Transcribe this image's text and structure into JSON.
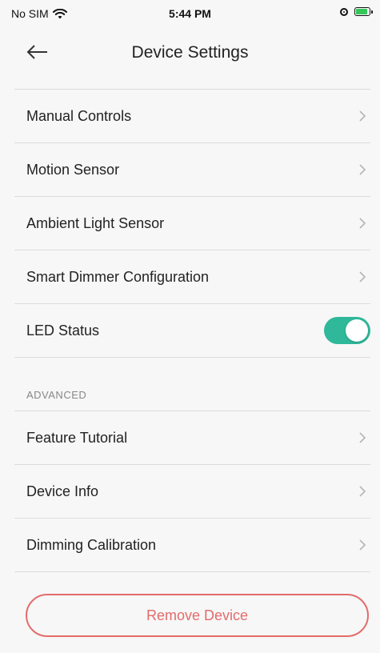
{
  "status_bar": {
    "carrier": "No SIM",
    "time": "5:44 PM"
  },
  "nav": {
    "title": "Device Settings"
  },
  "settings": {
    "items": [
      {
        "label": "Manual Controls"
      },
      {
        "label": "Motion Sensor"
      },
      {
        "label": "Ambient Light Sensor"
      },
      {
        "label": "Smart Dimmer Configuration"
      }
    ],
    "led_status": {
      "label": "LED Status",
      "on": true
    }
  },
  "advanced": {
    "header": "ADVANCED",
    "items": [
      {
        "label": "Feature Tutorial"
      },
      {
        "label": "Device Info"
      },
      {
        "label": "Dimming Calibration"
      }
    ]
  },
  "actions": {
    "remove_label": "Remove Device"
  },
  "colors": {
    "toggle_on": "#2fb89a",
    "destructive": "#e46b6b",
    "background": "#f7f7f7"
  },
  "icons": {
    "back": "arrow-left-icon",
    "chevron": "chevron-right-icon",
    "wifi": "wifi-icon",
    "orientation_lock": "orientation-lock-icon",
    "battery": "battery-charging-icon"
  }
}
